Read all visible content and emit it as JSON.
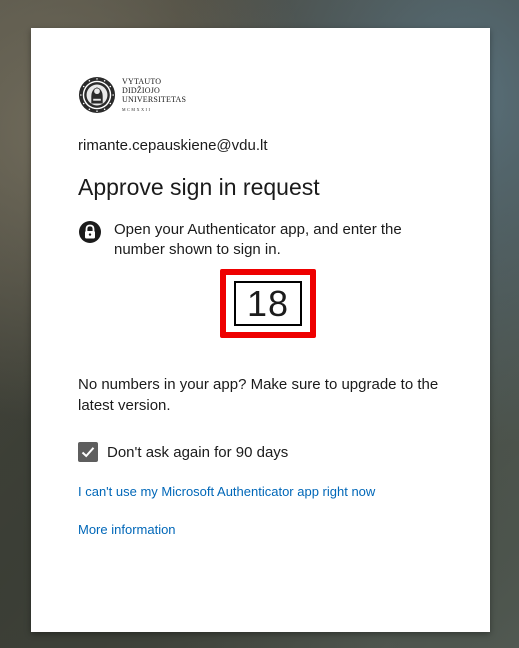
{
  "logo": {
    "line1": "VYTAUTO",
    "line2": "DIDŽIOJO",
    "line3": "UNIVERSITETAS",
    "line4": "MCMXXII",
    "seal_icon": "university-seal-icon"
  },
  "account": {
    "email": "rimante.cepauskiene@vdu.lt"
  },
  "page": {
    "title": "Approve sign in request",
    "instruction": "Open your Authenticator app, and enter the number shown to sign in.",
    "instruction_icon": "lock-icon",
    "number": "18",
    "no_numbers_text": "No numbers in your app? Make sure to upgrade to the latest version."
  },
  "remember": {
    "label": "Don't ask again for 90 days",
    "checked": true
  },
  "links": {
    "cant_use": "I can't use my Microsoft Authenticator app right now",
    "more_info": "More information"
  },
  "colors": {
    "link": "#0067b8",
    "highlight": "#ee0000",
    "checkbox": "#5e5e5e"
  }
}
